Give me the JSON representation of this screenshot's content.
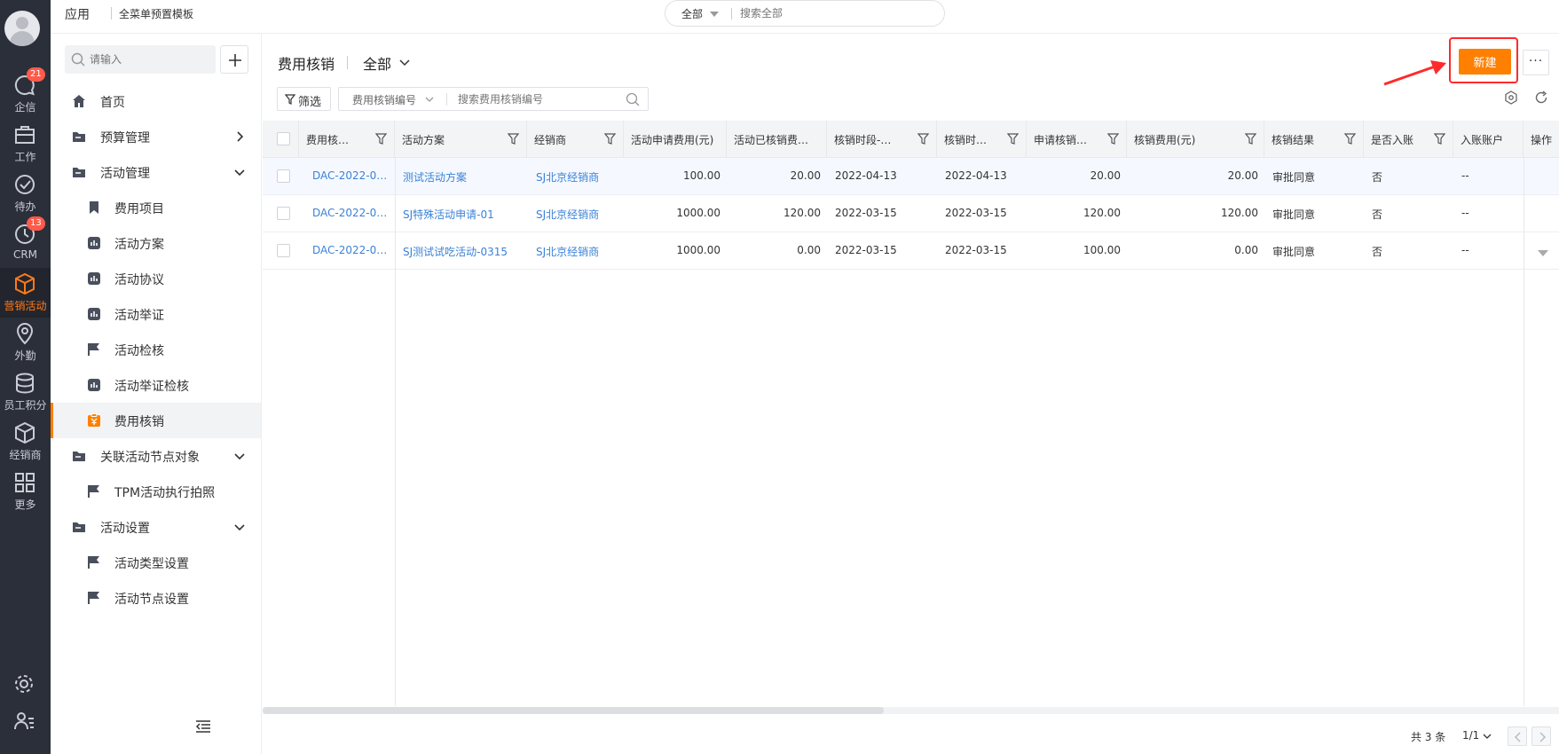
{
  "iconbar": {
    "items": [
      {
        "label": "企信",
        "badge": "21"
      },
      {
        "label": "工作",
        "badge": ""
      },
      {
        "label": "待办",
        "badge": ""
      },
      {
        "label": "CRM",
        "badge": "13"
      },
      {
        "label": "营销活动",
        "badge": ""
      },
      {
        "label": "外勤",
        "badge": ""
      },
      {
        "label": "员工积分",
        "badge": ""
      },
      {
        "label": "经销商",
        "badge": ""
      },
      {
        "label": "更多",
        "badge": ""
      }
    ],
    "active_color": "#ff7a1a"
  },
  "topbar": {
    "app_label": "应用",
    "template_label": "全菜单预置模板",
    "search_scope": "全部",
    "search_placeholder": "搜索全部"
  },
  "menu": {
    "search_placeholder": "请输入",
    "items": [
      {
        "label": "首页",
        "icon": "home-icon"
      },
      {
        "label": "预算管理",
        "icon": "folder-icon"
      },
      {
        "label": "活动管理",
        "icon": "folder-icon"
      },
      {
        "label": "费用项目",
        "icon": "bookmark-icon"
      },
      {
        "label": "活动方案",
        "icon": "chart-icon"
      },
      {
        "label": "活动协议",
        "icon": "chart-icon"
      },
      {
        "label": "活动举证",
        "icon": "chart-icon"
      },
      {
        "label": "活动检核",
        "icon": "flag-icon"
      },
      {
        "label": "活动举证检核",
        "icon": "chart-icon"
      },
      {
        "label": "费用核销",
        "icon": "expense-icon"
      },
      {
        "label": "关联活动节点对象",
        "icon": "folder-icon"
      },
      {
        "label": "TPM活动执行拍照",
        "icon": "flag-icon"
      },
      {
        "label": "活动设置",
        "icon": "folder-icon"
      },
      {
        "label": "活动类型设置",
        "icon": "flag-icon"
      },
      {
        "label": "活动节点设置",
        "icon": "flag-icon"
      }
    ]
  },
  "main": {
    "title": "费用核销",
    "scene": "全部",
    "new_label": "新建",
    "more_label": "···",
    "filter_label": "筛选",
    "field_search_label": "费用核销编号",
    "field_search_placeholder": "搜索费用核销编号",
    "brand_color": "#ff8000",
    "highlight_color": "#ff2a2a"
  },
  "table": {
    "columns": [
      "费用核…",
      "活动方案",
      "经销商",
      "活动申请费用(元)",
      "活动已核销费…",
      "核销时段-…",
      "核销时…",
      "申请核销…",
      "核销费用(元)",
      "核销结果",
      "是否入账",
      "入账账户",
      "操作"
    ],
    "rows": [
      [
        "DAC-2022-0…",
        "测试活动方案",
        "SJ北京经销商",
        "100.00",
        "20.00",
        "2022-04-13",
        "2022-04-13",
        "20.00",
        "20.00",
        "审批同意",
        "否",
        "--"
      ],
      [
        "DAC-2022-0…",
        "SJ特殊活动申请-01",
        "SJ北京经销商",
        "1000.00",
        "120.00",
        "2022-03-15",
        "2022-03-15",
        "120.00",
        "120.00",
        "审批同意",
        "否",
        "--"
      ],
      [
        "DAC-2022-0…",
        "SJ测试试吃活动-0315",
        "SJ北京经销商",
        "1000.00",
        "0.00",
        "2022-03-15",
        "2022-03-15",
        "100.00",
        "0.00",
        "审批同意",
        "否",
        "--"
      ]
    ],
    "link_color": "#3b82d8"
  },
  "pager": {
    "total": "共 3 条",
    "page": "1/1"
  }
}
